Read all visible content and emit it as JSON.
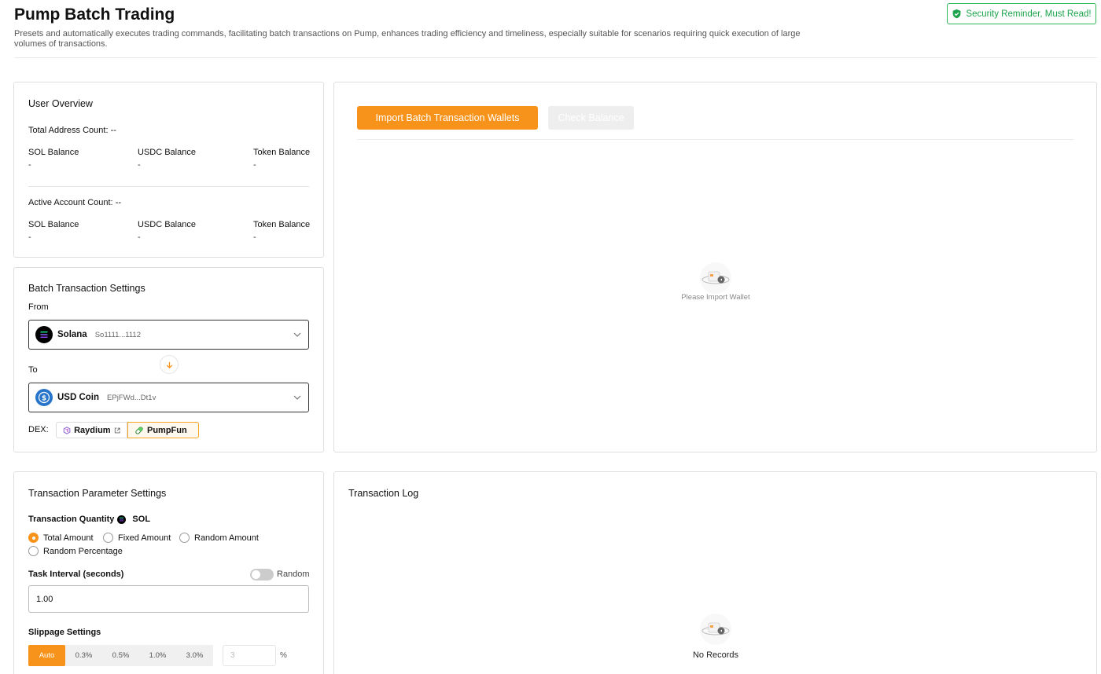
{
  "header": {
    "title": "Pump Batch Trading",
    "description": "Presets and automatically executes trading commands, facilitating batch transactions on Pump, enhances trading efficiency and timeliness, especially suitable for scenarios requiring quick execution of large volumes of transactions.",
    "security_label": "Security Reminder, Must Read!",
    "security_icon": "shield-check-icon"
  },
  "overview": {
    "title": "User Overview",
    "total_label": "Total Address Count:",
    "total_value": "--",
    "active_label": "Active Account Count:",
    "active_value": "--",
    "total_balances": [
      {
        "label": "SOL Balance",
        "value": "-"
      },
      {
        "label": "USDC Balance",
        "value": "-"
      },
      {
        "label": "Token Balance",
        "value": "-"
      }
    ],
    "active_balances": [
      {
        "label": "SOL Balance",
        "value": "-"
      },
      {
        "label": "USDC Balance",
        "value": "-"
      },
      {
        "label": "Token Balance",
        "value": "-"
      }
    ]
  },
  "batch": {
    "title": "Batch Transaction Settings",
    "from_label": "From",
    "to_label": "To",
    "from_token": {
      "name": "Solana",
      "address": "So1111...1112",
      "icon": "solana-icon"
    },
    "to_token": {
      "name": "USD Coin",
      "address": "EPjFWd...Dt1v",
      "icon": "usdc-icon"
    },
    "dex_label": "DEX:",
    "dex_options": [
      {
        "label": "Raydium",
        "icon": "raydium-icon",
        "selected": false
      },
      {
        "label": "PumpFun",
        "icon": "pumpfun-icon",
        "selected": true
      }
    ]
  },
  "wallets": {
    "import_label": "Import Batch Transaction Wallets",
    "check_label": "Check Balance",
    "empty_text": "Please Import Wallet"
  },
  "params": {
    "title": "Transaction Parameter Settings",
    "quantity_label": "Transaction Quantity",
    "quantity_token": "SOL",
    "amount_modes": [
      {
        "label": "Total Amount",
        "checked": true
      },
      {
        "label": "Fixed Amount",
        "checked": false
      },
      {
        "label": "Random Amount",
        "checked": false
      },
      {
        "label": "Random Percentage",
        "checked": false
      }
    ],
    "interval_label": "Task Interval (seconds)",
    "random_label": "Random",
    "random_enabled": false,
    "interval_value": "1.00",
    "slippage_label": "Slippage Settings",
    "slippage_options": [
      "Auto",
      "0.3%",
      "0.5%",
      "1.0%",
      "3.0%"
    ],
    "slippage_selected": "Auto",
    "slippage_custom_placeholder": "3",
    "slippage_unit": "%"
  },
  "log": {
    "title": "Transaction Log",
    "empty_text": "No Records"
  },
  "colors": {
    "accent": "#f7931a",
    "security_green": "#1aa34a"
  }
}
